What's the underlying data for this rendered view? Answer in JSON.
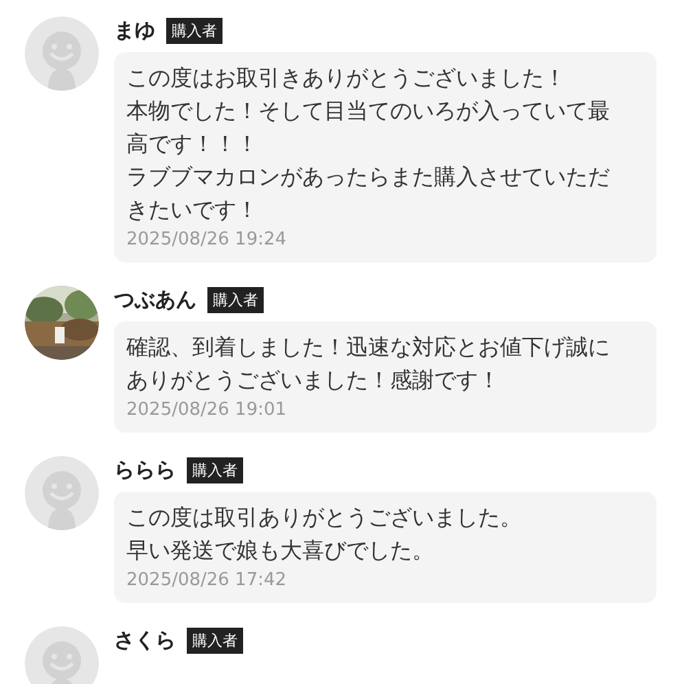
{
  "comments": [
    {
      "avatar": {
        "kind": "default"
      },
      "name": "まゆ",
      "badge": "購入者",
      "lines": [
        "この度はお取引きありがとうございました！",
        "本物でした！そして目当てのいろが入っていて最",
        "高です！！！",
        "ラブブマカロンがあったらまた購入させていただ",
        "きたいです！"
      ],
      "time": "2025/08/26 19:24"
    },
    {
      "name": "つぶあん",
      "badge": "購入者",
      "lines": [
        "確認、到着しました！迅速な対応とお値下げ誠に",
        "ありがとうございました！感謝です！"
      ],
      "time": "2025/08/26 19:01"
    },
    {
      "avatar": {
        "kind": "default"
      },
      "name": "ららら",
      "badge": "購入者",
      "lines": [
        "この度は取引ありがとうございました。",
        "早い発送で娘も大喜びでした。"
      ],
      "time": "2025/08/26 17:42"
    },
    {
      "avatar": {
        "kind": "default"
      },
      "name": "さくら",
      "badge": "購入者"
    }
  ]
}
